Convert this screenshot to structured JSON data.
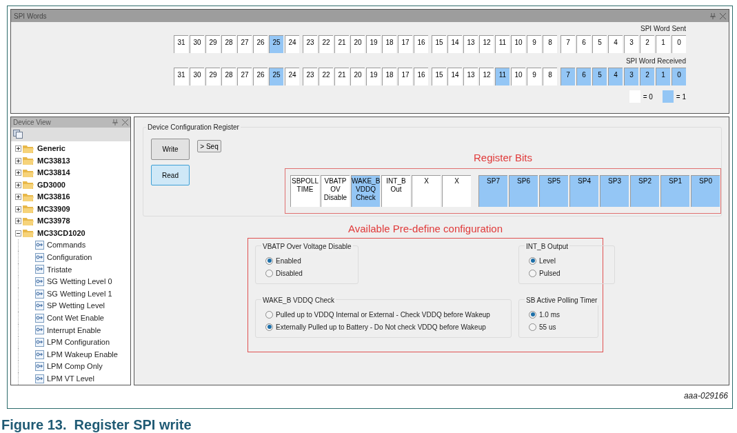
{
  "spi_words": {
    "title": "SPI Words",
    "rows": [
      {
        "label": "SPI Word Sent",
        "bits": [
          {
            "label": "31",
            "set": false
          },
          {
            "label": "30",
            "set": false
          },
          {
            "label": "29",
            "set": false
          },
          {
            "label": "28",
            "set": false
          },
          {
            "label": "27",
            "set": false
          },
          {
            "label": "26",
            "set": false
          },
          {
            "label": "25",
            "set": true
          },
          {
            "label": "24",
            "set": false
          },
          {
            "label": "23",
            "set": false
          },
          {
            "label": "22",
            "set": false
          },
          {
            "label": "21",
            "set": false
          },
          {
            "label": "20",
            "set": false
          },
          {
            "label": "19",
            "set": false
          },
          {
            "label": "18",
            "set": false
          },
          {
            "label": "17",
            "set": false
          },
          {
            "label": "16",
            "set": false
          },
          {
            "label": "15",
            "set": false
          },
          {
            "label": "14",
            "set": false
          },
          {
            "label": "13",
            "set": false
          },
          {
            "label": "12",
            "set": false
          },
          {
            "label": "11",
            "set": false
          },
          {
            "label": "10",
            "set": false
          },
          {
            "label": "9",
            "set": false
          },
          {
            "label": "8",
            "set": false
          },
          {
            "label": "7",
            "set": false
          },
          {
            "label": "6",
            "set": false
          },
          {
            "label": "5",
            "set": false
          },
          {
            "label": "4",
            "set": false
          },
          {
            "label": "3",
            "set": false
          },
          {
            "label": "2",
            "set": false
          },
          {
            "label": "1",
            "set": false
          },
          {
            "label": "0",
            "set": false
          }
        ]
      },
      {
        "label": "SPI Word Received",
        "bits": [
          {
            "label": "31",
            "set": false
          },
          {
            "label": "30",
            "set": false
          },
          {
            "label": "29",
            "set": false
          },
          {
            "label": "28",
            "set": false
          },
          {
            "label": "27",
            "set": false
          },
          {
            "label": "26",
            "set": false
          },
          {
            "label": "25",
            "set": true
          },
          {
            "label": "24",
            "set": false
          },
          {
            "label": "23",
            "set": false
          },
          {
            "label": "22",
            "set": false
          },
          {
            "label": "21",
            "set": false
          },
          {
            "label": "20",
            "set": false
          },
          {
            "label": "19",
            "set": false
          },
          {
            "label": "18",
            "set": false
          },
          {
            "label": "17",
            "set": false
          },
          {
            "label": "16",
            "set": false
          },
          {
            "label": "15",
            "set": false
          },
          {
            "label": "14",
            "set": false
          },
          {
            "label": "13",
            "set": false
          },
          {
            "label": "12",
            "set": false
          },
          {
            "label": "11",
            "set": true
          },
          {
            "label": "10",
            "set": false
          },
          {
            "label": "9",
            "set": false
          },
          {
            "label": "8",
            "set": false
          },
          {
            "label": "7",
            "set": true
          },
          {
            "label": "6",
            "set": true
          },
          {
            "label": "5",
            "set": true
          },
          {
            "label": "4",
            "set": true
          },
          {
            "label": "3",
            "set": true
          },
          {
            "label": "2",
            "set": true
          },
          {
            "label": "1",
            "set": true
          },
          {
            "label": "0",
            "set": true
          }
        ]
      }
    ],
    "legend": [
      {
        "label": "= 0",
        "set": false
      },
      {
        "label": "= 1",
        "set": true
      }
    ]
  },
  "device_view": {
    "title": "Device View",
    "tree": [
      {
        "label": "Generic",
        "expanded": false
      },
      {
        "label": "MC33813",
        "expanded": false
      },
      {
        "label": "MC33814",
        "expanded": false
      },
      {
        "label": "GD3000",
        "expanded": false
      },
      {
        "label": "MC33816",
        "expanded": false
      },
      {
        "label": "MC33909",
        "expanded": false
      },
      {
        "label": "MC33978",
        "expanded": false
      },
      {
        "label": "MC33CD1020",
        "expanded": true,
        "children": [
          {
            "label": "Commands"
          },
          {
            "label": "Configuration"
          },
          {
            "label": "Tristate"
          },
          {
            "label": "SG Wetting Level 0"
          },
          {
            "label": "SG Wetting Level 1"
          },
          {
            "label": "SP Wetting Level"
          },
          {
            "label": "Cont Wet Enable"
          },
          {
            "label": "Interrupt Enable"
          },
          {
            "label": "LPM Configuration"
          },
          {
            "label": "LPM Wakeup Enable"
          },
          {
            "label": "LPM Comp Only"
          },
          {
            "label": "LPM VT Level"
          }
        ]
      }
    ]
  },
  "register": {
    "title": "Device Configuration Register",
    "write_button": "Write",
    "seq_button": "> Seq",
    "read_button": "Read",
    "bits_label": "Register Bits",
    "bits": [
      {
        "label": "SBPOLL\nTIME",
        "set": false
      },
      {
        "label": "VBATP\nOV\nDisable",
        "set": false
      },
      {
        "label": "WAKE_B\nVDDQ\nCheck",
        "set": true
      },
      {
        "label": "INT_B\nOut",
        "set": false
      },
      {
        "label": "X",
        "set": false
      },
      {
        "label": "X",
        "set": false
      },
      {
        "label": "SP7",
        "set": true
      },
      {
        "label": "SP6",
        "set": true
      },
      {
        "label": "SP5",
        "set": true
      },
      {
        "label": "SP4",
        "set": true
      },
      {
        "label": "SP3",
        "set": true
      },
      {
        "label": "SP2",
        "set": true
      },
      {
        "label": "SP1",
        "set": true
      },
      {
        "label": "SP0",
        "set": true
      }
    ]
  },
  "predefine": {
    "label": "Available Pre-define configuration",
    "groups": [
      {
        "title": "VBATP Over Voltage Disable",
        "options": [
          {
            "label": "Enabled",
            "selected": true
          },
          {
            "label": "Disabled",
            "selected": false
          }
        ]
      },
      {
        "title": "INT_B Output",
        "options": [
          {
            "label": "Level",
            "selected": true
          },
          {
            "label": "Pulsed",
            "selected": false
          }
        ]
      },
      {
        "title": "WAKE_B VDDQ Check",
        "options": [
          {
            "label": "Pulled up to VDDQ Internal or External - Check VDDQ before Wakeup",
            "selected": false
          },
          {
            "label": "Externally Pulled up to Battery - Do Not check VDDQ before Wakeup",
            "selected": true
          }
        ]
      },
      {
        "title": "SB Active Polling Timer",
        "options": [
          {
            "label": "1.0 ms",
            "selected": true
          },
          {
            "label": "55 us",
            "selected": false
          }
        ]
      }
    ]
  },
  "figure": {
    "id": "aaa-029166",
    "caption": "Figure 13.  Register SPI write"
  }
}
